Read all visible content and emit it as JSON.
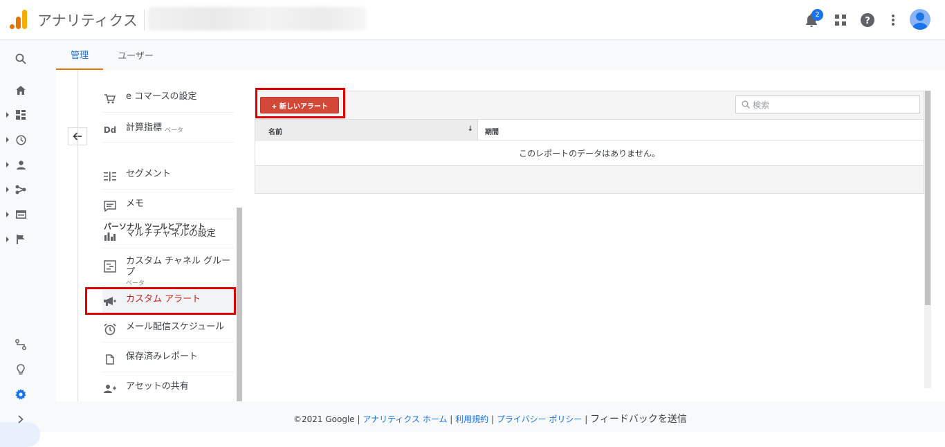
{
  "header": {
    "app_title": "アナリティクス",
    "notification_count": "2"
  },
  "tabs": [
    {
      "label": "管理"
    },
    {
      "label": "ユーザー"
    }
  ],
  "nav": {
    "items": [
      {
        "label": "e コマースの設定",
        "sub": ""
      },
      {
        "label": "計算指標",
        "sub": "ベータ"
      },
      {
        "label": "セグメント",
        "sub": ""
      },
      {
        "label": "メモ",
        "sub": ""
      },
      {
        "label": "マルチチャネルの設定",
        "sub": ""
      },
      {
        "label": "カスタム チャネル グループ",
        "sub": "ベータ"
      },
      {
        "label": "カスタム アラート",
        "sub": ""
      },
      {
        "label": "メール配信スケジュール",
        "sub": ""
      },
      {
        "label": "保存済みレポート",
        "sub": ""
      },
      {
        "label": "アセットの共有",
        "sub": ""
      }
    ],
    "section_heading": "パーソナル ツールとアセット",
    "active_item": "カスタム アラート"
  },
  "report": {
    "new_alert_label": "+ 新しいアラート",
    "search_placeholder": "検索",
    "columns": [
      "名前",
      "期間"
    ],
    "sort_indicator": "↓",
    "empty_message": "このレポートのデータはありません。"
  },
  "footer": {
    "copyright": "©2021 Google",
    "sep": " | ",
    "links": [
      "アナリティクス ホーム",
      "利用規約",
      "プライバシー ポリシー"
    ],
    "feedback": "フィードバックを送信"
  },
  "colors": {
    "accent": "#1a73e8",
    "tab_underline": "#e37400",
    "alert_button": "#d34836",
    "highlight": "#e00000",
    "active_nav": "#c5221f"
  }
}
